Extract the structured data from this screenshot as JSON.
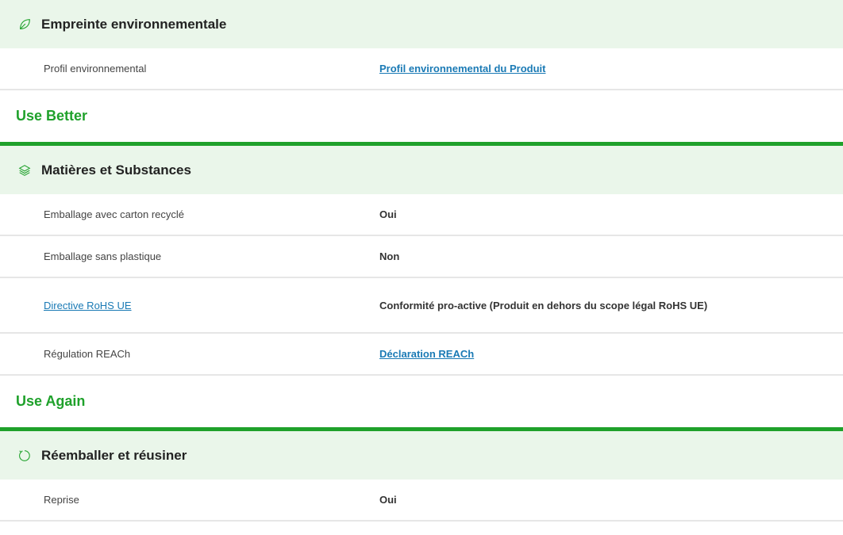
{
  "sections": [
    {
      "icon": "leaf-icon",
      "title": "Empreinte environnementale",
      "rows": [
        {
          "label": "Profil environnemental",
          "value": "Profil environnemental du Produit"
        }
      ]
    },
    {
      "icon": "layers-icon",
      "title": "Matières et Substances",
      "rows": [
        {
          "label": "Emballage avec carton recyclé",
          "value": "Oui"
        },
        {
          "label": "Emballage sans plastique",
          "value": "Non"
        },
        {
          "label": "Directive RoHS UE",
          "value": "Conformité pro-active (Produit en dehors du scope légal RoHS UE)"
        },
        {
          "label": "Régulation REACh",
          "value": "Déclaration REACh"
        }
      ]
    },
    {
      "icon": "refresh-icon",
      "title": "Réemballer et réusiner",
      "rows": [
        {
          "label": "Reprise",
          "value": "Oui"
        }
      ]
    }
  ],
  "groups": {
    "use_better": "Use Better",
    "use_again": "Use Again"
  },
  "colors": {
    "accent_green": "#1fa12b",
    "header_bg": "#eaf6ea",
    "link": "#1a7ab5"
  }
}
